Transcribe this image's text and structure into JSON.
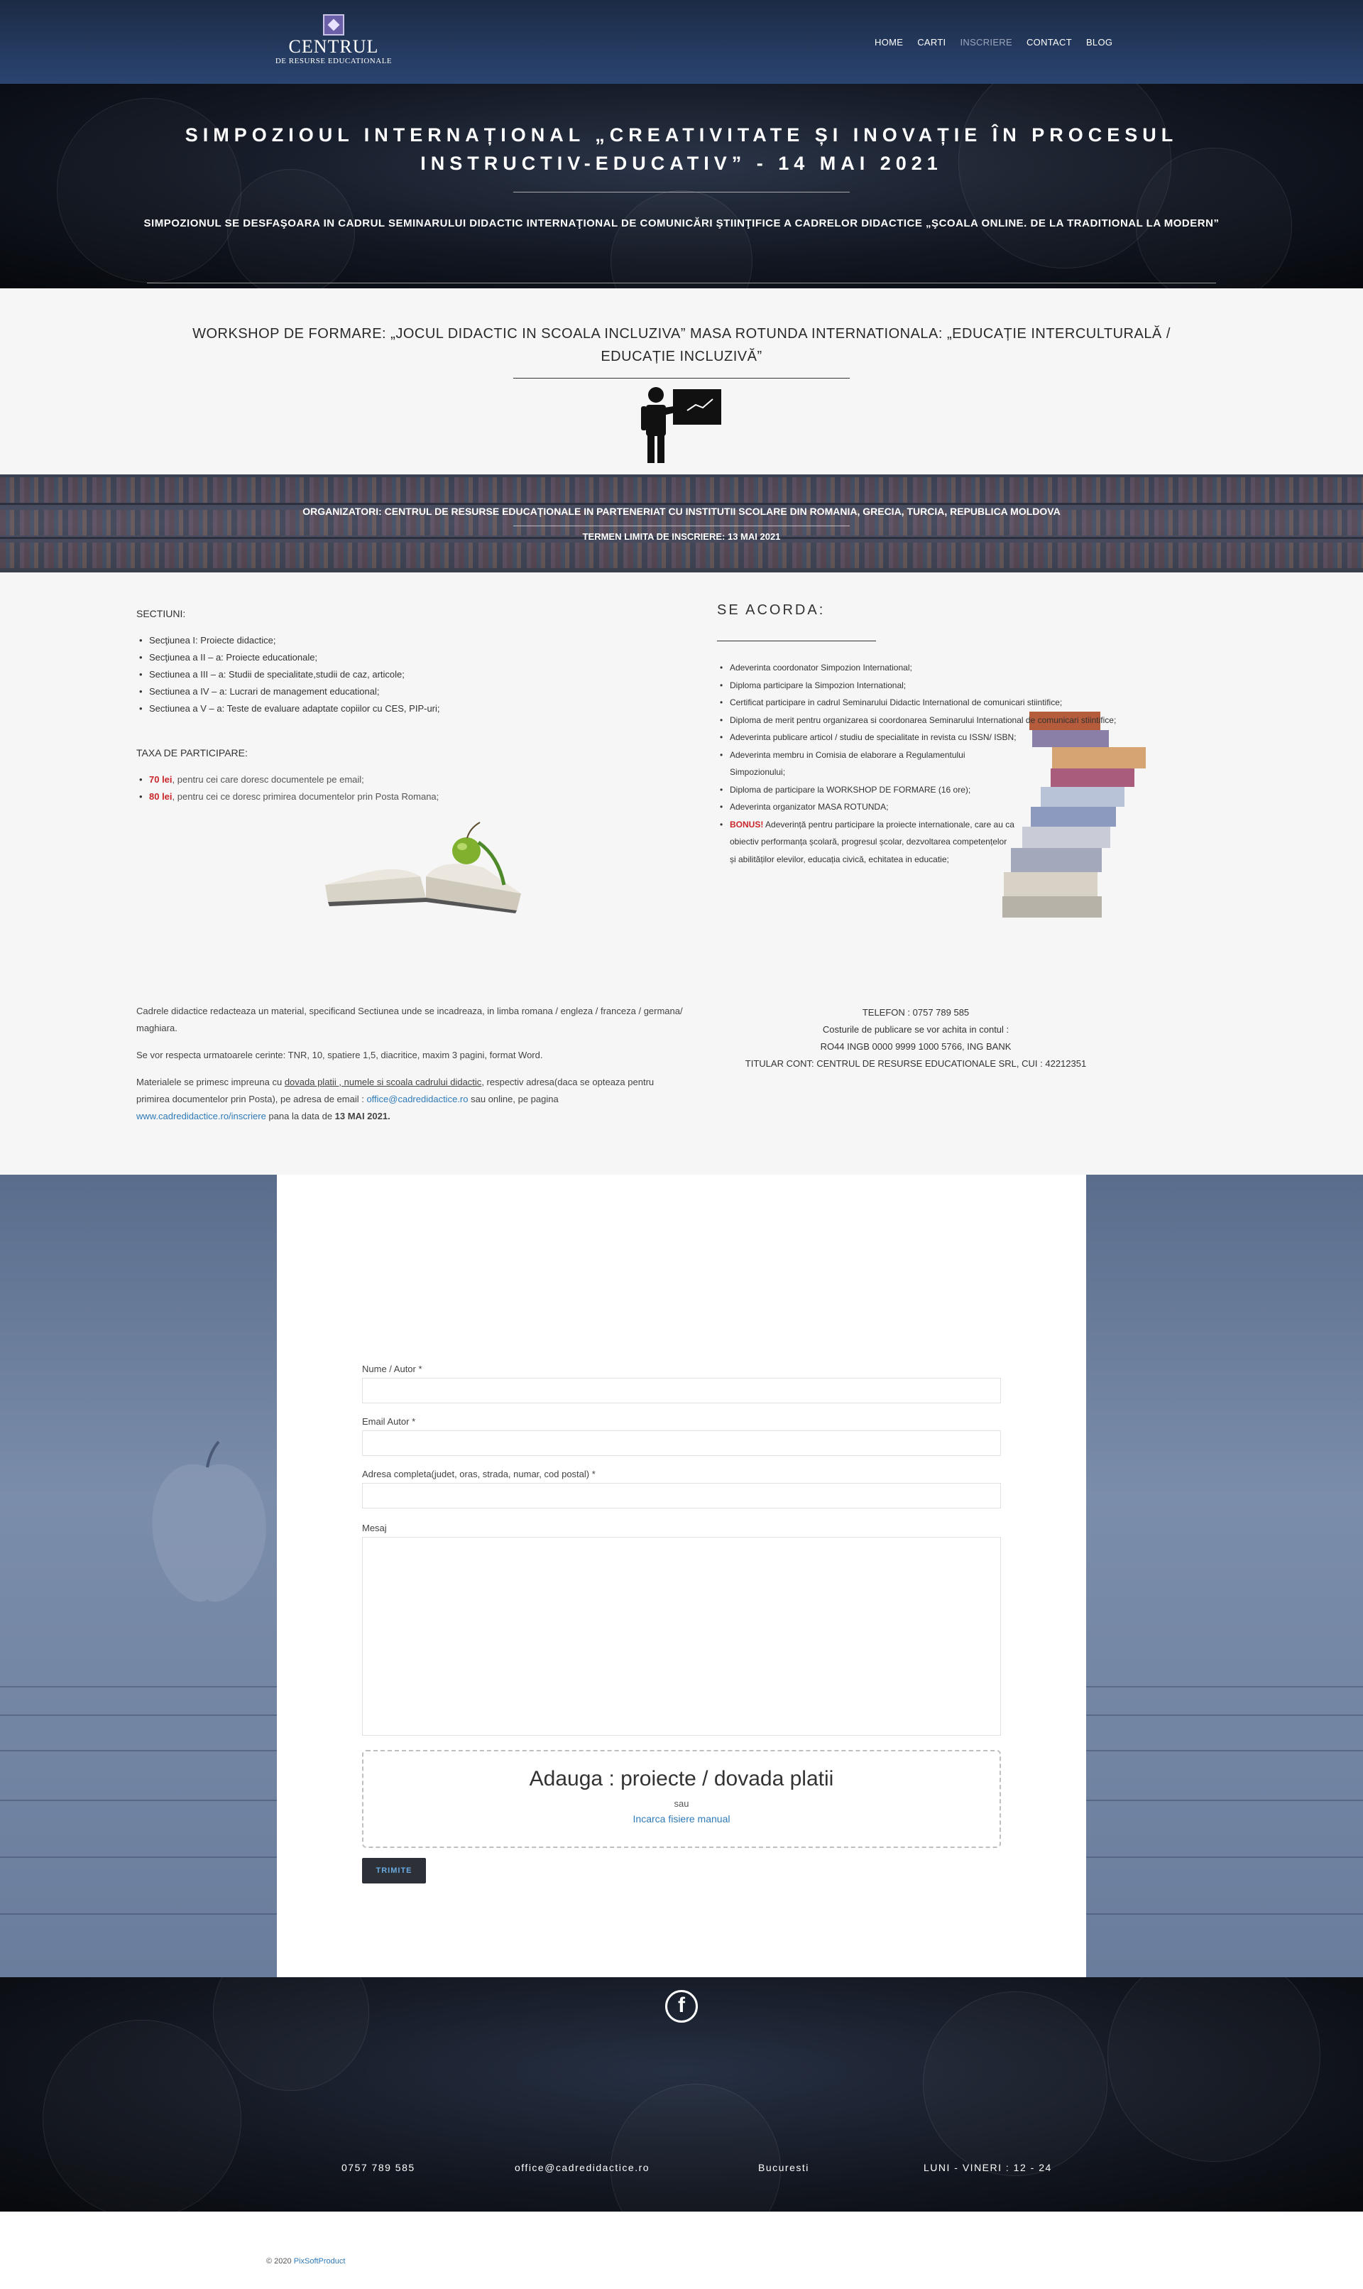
{
  "header": {
    "logo_title": "CENTRUL",
    "logo_subtitle": "DE RESURSE EDUCATIONALE",
    "nav": [
      "HOME",
      "CARTI",
      "INSCRIERE",
      "CONTACT",
      "BLOG"
    ],
    "active_nav": "INSCRIERE"
  },
  "hero": {
    "title": "SIMPOZIOUL INTERNAȚIONAL „CREATIVITATE ȘI INOVAȚIE ÎN PROCESUL INSTRUCTIV-EDUCATIV” - 14 MAI 2021",
    "subtitle": "SIMPOZIONUL SE DESFAŞOARA IN CADRUL SEMINARULUI DIDACTIC INTERNAŢIONAL DE COMUNICĂRI ŞTIINŢIFICE A CADRELOR DIDACTICE „ŞCOALA ONLINE. DE LA TRADITIONAL LA MODERN”"
  },
  "workshop": {
    "title": "WORKSHOP DE FORMARE: „JOCUL DIDACTIC IN SCOALA INCLUZIVA” MASA ROTUNDA INTERNATIONALA: „EDUCAȚIE INTERCULTURALĂ / EDUCAȚIE INCLUZIVĂ”",
    "icon": "teacher-board-icon"
  },
  "banner": {
    "organizers": "ORGANIZATORI: CENTRUL DE RESURSE EDUCAȚIONALE IN PARTENERIAT CU INSTITUTII SCOLARE DIN ROMANIA, GRECIA, TURCIA, REPUBLICA MOLDOVA",
    "deadline": "TERMEN LIMITA DE INSCRIERE: 13 MAI 2021"
  },
  "sections": {
    "label": "SECTIUNI:",
    "items": [
      "Secţiunea I:  Proiecte didactice;",
      "Secţiunea  a II – a:  Proiecte educationale;",
      "Sectiunea a III – a: Studii de specialitate,studii de caz, articole;",
      "Sectiunea a IV –  a: Lucrari de management educational;",
      "Sectiunea a V – a: Teste de evaluare adaptate copiilor cu CES, PIP-uri;"
    ]
  },
  "fees": {
    "label": "TAXA DE PARTICIPARE:",
    "items": [
      {
        "price": "70 lei",
        "text": ", pentru cei care doresc documentele pe email;"
      },
      {
        "price": "80 lei",
        "text": ", pentru cei ce doresc primirea documentelor prin Posta Romana;"
      }
    ]
  },
  "awards": {
    "title": "SE ACORDA:",
    "items": [
      "Adeverinta coordonator Simpozion International;",
      "Diploma participare la Simpozion International;",
      "Certificat participare in cadrul Seminarului Didactic International de comunicari stiintifice;",
      "Diploma de merit pentru organizarea si coordonarea Seminarului International de comunicari stiintifice;",
      "Adeverinta publicare articol / studiu de specialitate in revista cu ISSN/ ISBN;",
      "Adeverinta membru in Comisia de elaborare a Regulamentului Simpozionului;",
      "Diploma de participare la WORKSHOP DE FORMARE (16 ore);",
      "Adeverinta organizator MASA ROTUNDA;"
    ],
    "bonus_label": "BONUS!",
    "bonus_text": " Adeverință pentru participare la proiecte internationale, care au ca obiectiv performanța școlară, progresul școlar, dezvoltarea competențelor și abilităților elevilor, educația civică, echitatea in educatie;"
  },
  "instructions": {
    "p1": " Cadrele didactice redacteaza un material, specificand Sectiunea unde se incadreaza, in limba romana / engleza / franceza / germana/ maghiara.",
    "p2": "Se vor respecta urmatoarele cerinte: TNR, 10, spatiere 1,5, diacritice, maxim 3 pagini, format Word.",
    "p3_a": "Materialele se primesc impreuna cu ",
    "p3_u": "dovada platii , numele si scoala cadrului didactic",
    "p3_b": ", respectiv adresa(daca se opteaza pentru primirea documentelor prin Posta), pe adresa de email :  ",
    "p3_email": "office@cadredidactice.ro",
    "p3_c": " sau online, pe pagina ",
    "p3_link": "www.cadredidactice.ro/inscriere",
    "p3_d": " pana la data de ",
    "p3_date": "13  MAI 2021."
  },
  "contact": {
    "phone": "TELEFON : 0757 789 585",
    "costs": "Costurile de publicare se vor achita in contul :",
    "iban": "RO44 INGB 0000 9999 1000 5766, ING BANK",
    "holder": "TITULAR CONT: CENTRUL DE RESURSE EDUCATIONALE SRL, CUI : 42212351"
  },
  "form": {
    "name_label": "Nume / Autor *",
    "email_label": "Email Autor *",
    "address_label": "Adresa completa(judet, oras, strada, numar, cod postal) *",
    "message_label": "Mesaj",
    "dropzone_title": "Adauga : proiecte / dovada platii",
    "dropzone_or": "sau",
    "dropzone_link": "Incarca fisiere manual",
    "submit": "TRIMITE"
  },
  "footer": {
    "facebook_icon": "facebook-icon",
    "phone": "0757 789 585",
    "email": "office@cadredidactice.ro",
    "city": "Bucuresti",
    "hours": "LUNI - VINERI : 12 - 24",
    "copyright_prefix": "© 2020 ",
    "copyright_link": "PixSoftProduct"
  }
}
